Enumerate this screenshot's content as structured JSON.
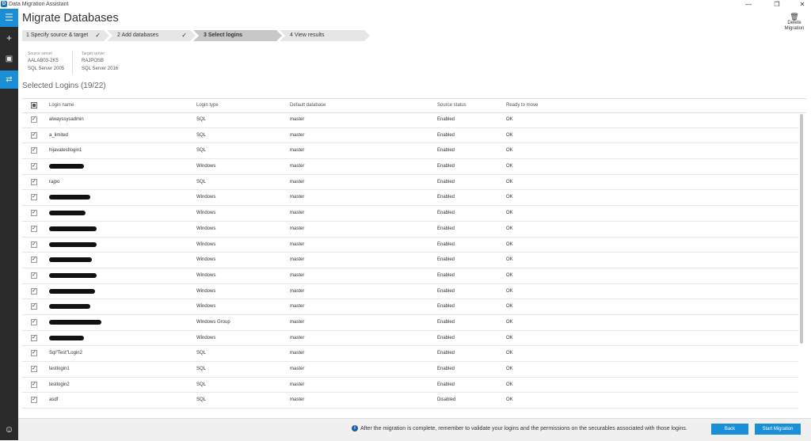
{
  "window": {
    "title": "Data Migration Assistant",
    "app_icon": "dma-app-icon"
  },
  "sidebar": {
    "items": [
      {
        "icon": "hamburger-menu-icon",
        "glyph": "☰"
      },
      {
        "icon": "plus-icon",
        "glyph": "+"
      },
      {
        "icon": "assessment-icon",
        "glyph": "▣"
      },
      {
        "icon": "migration-icon",
        "glyph": "⇄"
      },
      {
        "icon": "smiley-feedback-icon",
        "glyph": "☺"
      }
    ]
  },
  "header": {
    "page_title": "Migrate Databases",
    "delete_label_1": "Delete",
    "delete_label_2": "Migration"
  },
  "steps": [
    {
      "label": "1   Specify source & target",
      "done": true
    },
    {
      "label": "2   Add databases",
      "done": true
    },
    {
      "label": "3   Select logins",
      "active": true
    },
    {
      "label": "4   View results"
    }
  ],
  "source": {
    "label": "Source server",
    "name": "AALAB03-2K5",
    "version": "SQL Server 2005"
  },
  "target": {
    "label": "Target server",
    "name": "RAJPOSB",
    "version": "SQL Server 2016"
  },
  "selected_title": "Selected Logins (19/22)",
  "columns": {
    "login_name": "Login name",
    "login_type": "Login type",
    "default_db": "Default database",
    "source_status": "Source status",
    "ready": "Ready to move"
  },
  "rows": [
    {
      "name": "alwayssysadmin",
      "type": "SQL",
      "db": "master",
      "status": "Enabled",
      "ready": "OK"
    },
    {
      "name": "a_limited",
      "type": "SQL",
      "db": "master",
      "status": "Enabled",
      "ready": "OK"
    },
    {
      "name": "hijavatestlogin1",
      "type": "SQL",
      "db": "master",
      "status": "Enabled",
      "ready": "OK"
    },
    {
      "name": "",
      "redacted": 0.44,
      "type": "Windows",
      "db": "master",
      "status": "Enabled",
      "ready": "OK"
    },
    {
      "name": "rajpo",
      "type": "SQL",
      "db": "master",
      "status": "Enabled",
      "ready": "OK"
    },
    {
      "name": "",
      "redacted": 0.52,
      "type": "Windows",
      "db": "master",
      "status": "Enabled",
      "ready": "OK"
    },
    {
      "name": "",
      "redacted": 0.46,
      "type": "Windows",
      "db": "master",
      "status": "Enabled",
      "ready": "OK"
    },
    {
      "name": "",
      "redacted": 0.6,
      "type": "Windows",
      "db": "master",
      "status": "Enabled",
      "ready": "OK"
    },
    {
      "name": "",
      "redacted": 0.6,
      "type": "Windows",
      "db": "master",
      "status": "Enabled",
      "ready": "OK"
    },
    {
      "name": "",
      "redacted": 0.54,
      "type": "Windows",
      "db": "master",
      "status": "Enabled",
      "ready": "OK"
    },
    {
      "name": "",
      "redacted": 0.6,
      "type": "Windows",
      "db": "master",
      "status": "Enabled",
      "ready": "OK"
    },
    {
      "name": "",
      "redacted": 0.58,
      "type": "Windows",
      "db": "master",
      "status": "Enabled",
      "ready": "OK"
    },
    {
      "name": "",
      "redacted": 0.52,
      "type": "Windows",
      "db": "master",
      "status": "Enabled",
      "ready": "OK"
    },
    {
      "name": "",
      "redacted": 0.66,
      "type": "Windows Group",
      "db": "master",
      "status": "Enabled",
      "ready": "OK"
    },
    {
      "name": "",
      "redacted": 0.44,
      "type": "Windows",
      "db": "master",
      "status": "Enabled",
      "ready": "OK"
    },
    {
      "name": "Sql\"Test\"Login2",
      "type": "SQL",
      "db": "master",
      "status": "Enabled",
      "ready": "OK"
    },
    {
      "name": "testlogin1",
      "type": "SQL",
      "db": "master",
      "status": "Enabled",
      "ready": "OK"
    },
    {
      "name": "testlogin2",
      "type": "SQL",
      "db": "master",
      "status": "Enabled",
      "ready": "OK"
    },
    {
      "name": "asdf",
      "type": "SQL",
      "db": "master",
      "status": "Disabled",
      "ready": "OK"
    }
  ],
  "footer": {
    "message": "After the migration is complete, remember to validate your logins and the permissions on the securables associated with those logins.",
    "back_label": "Back",
    "start_label": "Start Migration"
  },
  "colors": {
    "accent": "#1a8fd8",
    "sidebar_bg": "#2b2b2b"
  }
}
